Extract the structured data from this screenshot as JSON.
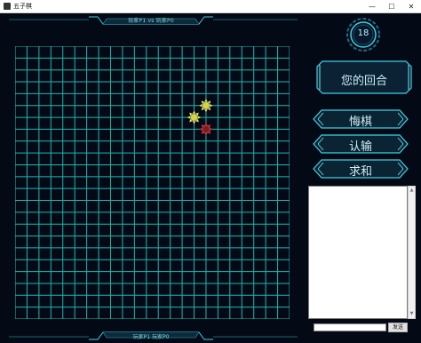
{
  "window": {
    "title": "五子棋",
    "controls": [
      "—",
      "☐",
      "✕"
    ]
  },
  "match": {
    "header": "玩家P1 vs 玩家P0",
    "footer": "玩家P1 玩家P0"
  },
  "timer": {
    "seconds": "18"
  },
  "turn": {
    "label": "您的回合"
  },
  "buttons": {
    "undo": "悔棋",
    "resign": "认输",
    "draw": "求和"
  },
  "chat": {
    "log": "",
    "input_value": "",
    "send_label": "发送"
  },
  "board": {
    "lines": 24,
    "stones": [
      {
        "col": 16,
        "row": 5,
        "color": "yellow"
      },
      {
        "col": 15,
        "row": 6,
        "color": "yellow"
      },
      {
        "col": 16,
        "row": 7,
        "color": "red"
      }
    ]
  },
  "colors": {
    "grid": "#1fb7b2",
    "accent": "#3fd0e6",
    "background": "#050b16"
  }
}
